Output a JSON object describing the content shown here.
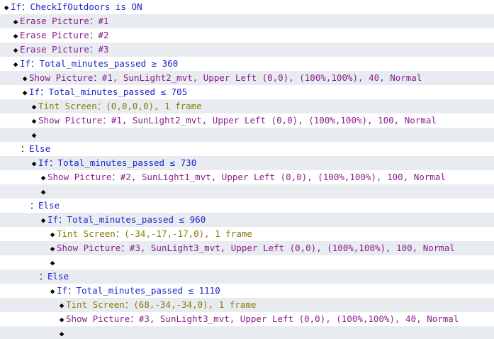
{
  "colors": {
    "conditional": "#1a24c8",
    "picture": "#8a1e8c",
    "screen": "#8a7a00",
    "marker": "#000000",
    "row_alt_background": "#e8ecf1"
  },
  "rows": [
    {
      "indent": 0,
      "marker": "◆",
      "text": "If：CheckIfOutdoors is ON",
      "kind": "conditional"
    },
    {
      "indent": 1,
      "marker": "◆",
      "text": "Erase Picture：#1",
      "kind": "picture"
    },
    {
      "indent": 1,
      "marker": "◆",
      "text": "Erase Picture：#2",
      "kind": "picture"
    },
    {
      "indent": 1,
      "marker": "◆",
      "text": "Erase Picture：#3",
      "kind": "picture"
    },
    {
      "indent": 1,
      "marker": "◆",
      "text": "If：Total_minutes_passed ≥ 360",
      "kind": "conditional"
    },
    {
      "indent": 2,
      "marker": "◆",
      "text": "Show Picture：#1, SunLight2_mvt, Upper Left (0,0), (100%,100%), 40, Normal",
      "kind": "picture"
    },
    {
      "indent": 2,
      "marker": "◆",
      "text": "If：Total_minutes_passed ≤ 705",
      "kind": "conditional"
    },
    {
      "indent": 3,
      "marker": "◆",
      "text": "Tint Screen：(0,0,0,0), 1 frame",
      "kind": "screen"
    },
    {
      "indent": 3,
      "marker": "◆",
      "text": "Show Picture：#1, SunLight2_mvt, Upper Left (0,0), (100%,100%), 100, Normal",
      "kind": "picture"
    },
    {
      "indent": 3,
      "marker": "◆",
      "text": "",
      "kind": "empty"
    },
    {
      "indent": 2,
      "marker": "：",
      "text": "Else",
      "kind": "conditional"
    },
    {
      "indent": 3,
      "marker": "◆",
      "text": "If：Total_minutes_passed ≤ 730",
      "kind": "conditional"
    },
    {
      "indent": 4,
      "marker": "◆",
      "text": "Show Picture：#2, SunLight1_mvt, Upper Left (0,0), (100%,100%), 100, Normal",
      "kind": "picture"
    },
    {
      "indent": 4,
      "marker": "◆",
      "text": "",
      "kind": "empty"
    },
    {
      "indent": 3,
      "marker": "：",
      "text": "Else",
      "kind": "conditional"
    },
    {
      "indent": 4,
      "marker": "◆",
      "text": "If：Total_minutes_passed ≤ 960",
      "kind": "conditional"
    },
    {
      "indent": 5,
      "marker": "◆",
      "text": "Tint Screen：(-34,-17,-17,0), 1 frame",
      "kind": "screen"
    },
    {
      "indent": 5,
      "marker": "◆",
      "text": "Show Picture：#3, SunLight3_mvt, Upper Left (0,0), (100%,100%), 100, Normal",
      "kind": "picture"
    },
    {
      "indent": 5,
      "marker": "◆",
      "text": "",
      "kind": "empty"
    },
    {
      "indent": 4,
      "marker": "：",
      "text": "Else",
      "kind": "conditional"
    },
    {
      "indent": 5,
      "marker": "◆",
      "text": "If：Total_minutes_passed ≤ 1110",
      "kind": "conditional"
    },
    {
      "indent": 6,
      "marker": "◆",
      "text": "Tint Screen：(68,-34,-34,0), 1 frame",
      "kind": "screen"
    },
    {
      "indent": 6,
      "marker": "◆",
      "text": "Show Picture：#3, SunLight3_mvt, Upper Left (0,0), (100%,100%), 40, Normal",
      "kind": "picture"
    },
    {
      "indent": 6,
      "marker": "◆",
      "text": "",
      "kind": "empty"
    }
  ]
}
